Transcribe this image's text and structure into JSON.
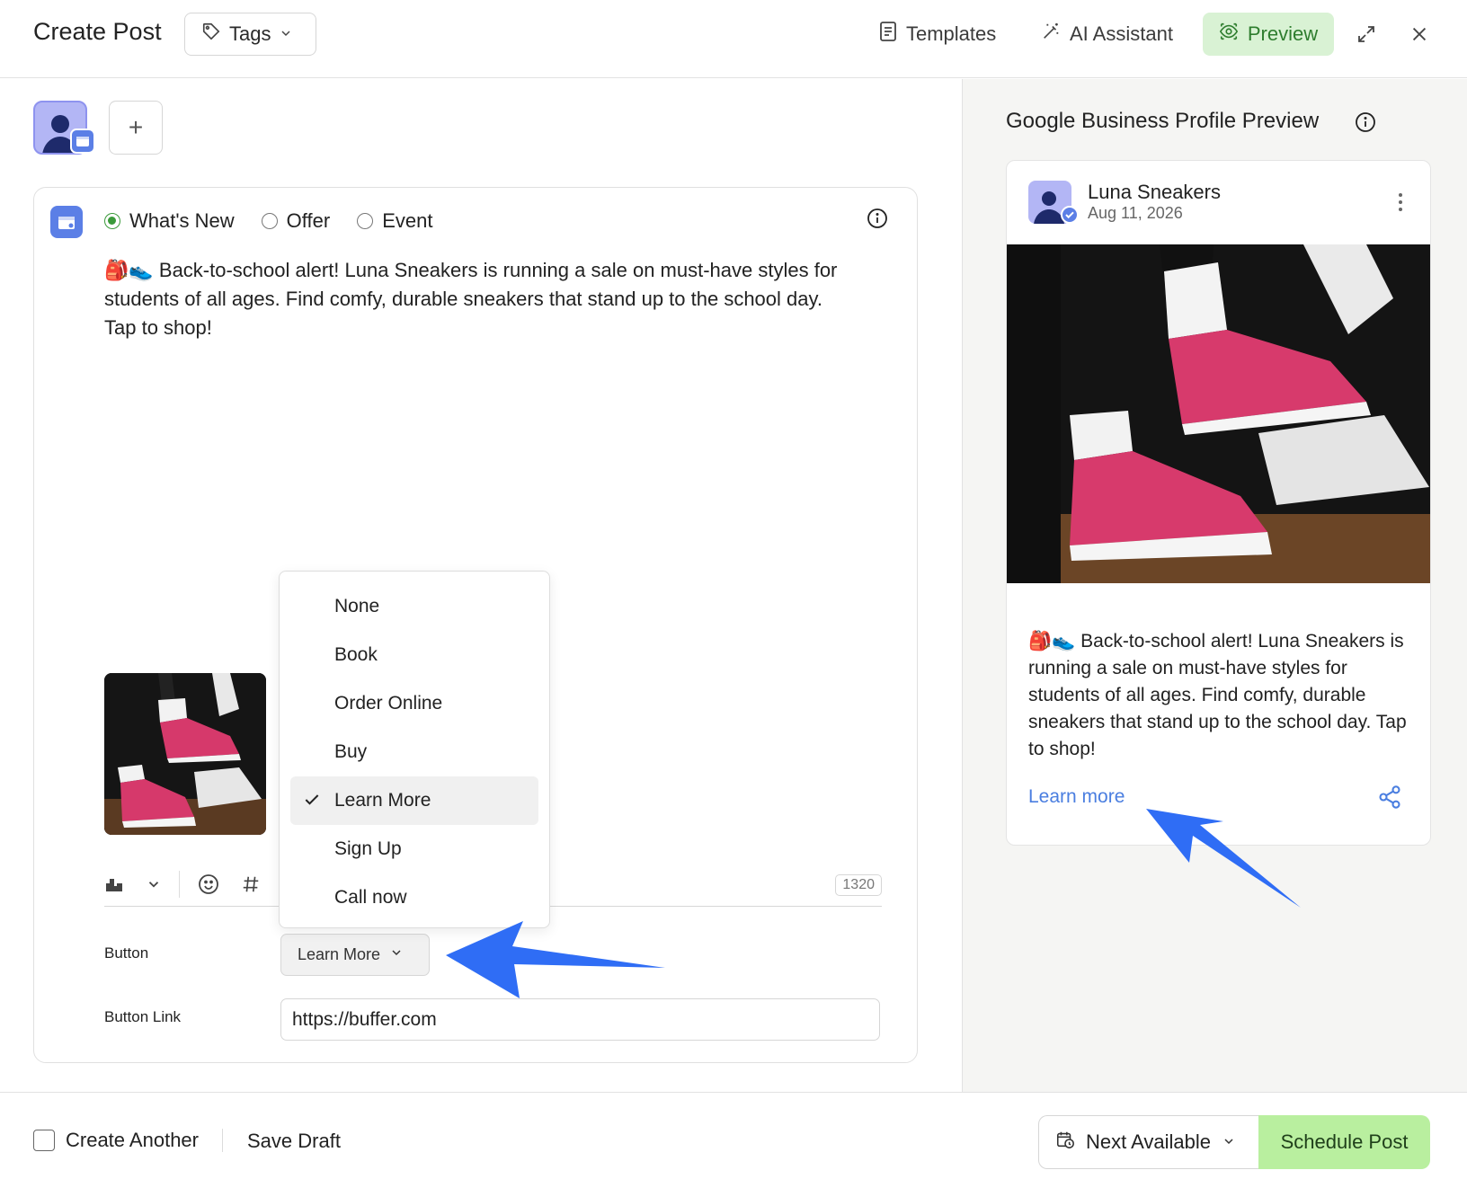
{
  "header": {
    "title": "Create Post",
    "tags_label": "Tags",
    "templates_label": "Templates",
    "ai_label": "AI Assistant",
    "preview_label": "Preview"
  },
  "editor": {
    "post_types": [
      {
        "label": "What's New",
        "selected": true
      },
      {
        "label": "Offer",
        "selected": false
      },
      {
        "label": "Event",
        "selected": false
      }
    ],
    "text": "🎒👟 Back-to-school alert! Luna Sneakers is running a sale on must-have styles for students of all ages. Find comfy, durable sneakers that stand up to the school day. Tap to shop!",
    "char_count": "1320",
    "button_label": "Button",
    "button_value": "Learn More",
    "button_link_label": "Button Link",
    "button_link_value": "https://buffer.com"
  },
  "dropdown": {
    "options": [
      "None",
      "Book",
      "Order Online",
      "Buy",
      "Learn More",
      "Sign Up",
      "Call now"
    ],
    "selected": "Learn More"
  },
  "footer": {
    "create_another": "Create Another",
    "save_draft": "Save Draft",
    "next_available": "Next Available",
    "schedule": "Schedule Post"
  },
  "preview_panel": {
    "title": "Google Business Profile Preview",
    "account_name": "Luna Sneakers",
    "date": "Aug 11, 2026",
    "text": "🎒👟 Back-to-school alert! Luna Sneakers is running a sale on must-have styles for students of all ages. Find comfy, durable sneakers that stand up to the school day. Tap to shop!",
    "cta": "Learn more"
  },
  "colors": {
    "accent_green": "#d9f2d4",
    "schedule_green": "#b9ef9f",
    "link_blue": "#4a7ee0",
    "arrow_blue": "#2f6df5",
    "avatar_purple": "#b3b6f5"
  },
  "icons": [
    "tag-icon",
    "chevron-down-icon",
    "template-icon",
    "magic-wand-icon",
    "eye-icon",
    "expand-icon",
    "close-icon",
    "plus-icon",
    "info-icon",
    "image-icon",
    "emoji-icon",
    "hashtag-icon",
    "check-icon",
    "calendar-clock-icon",
    "more-vertical-icon",
    "share-icon"
  ]
}
